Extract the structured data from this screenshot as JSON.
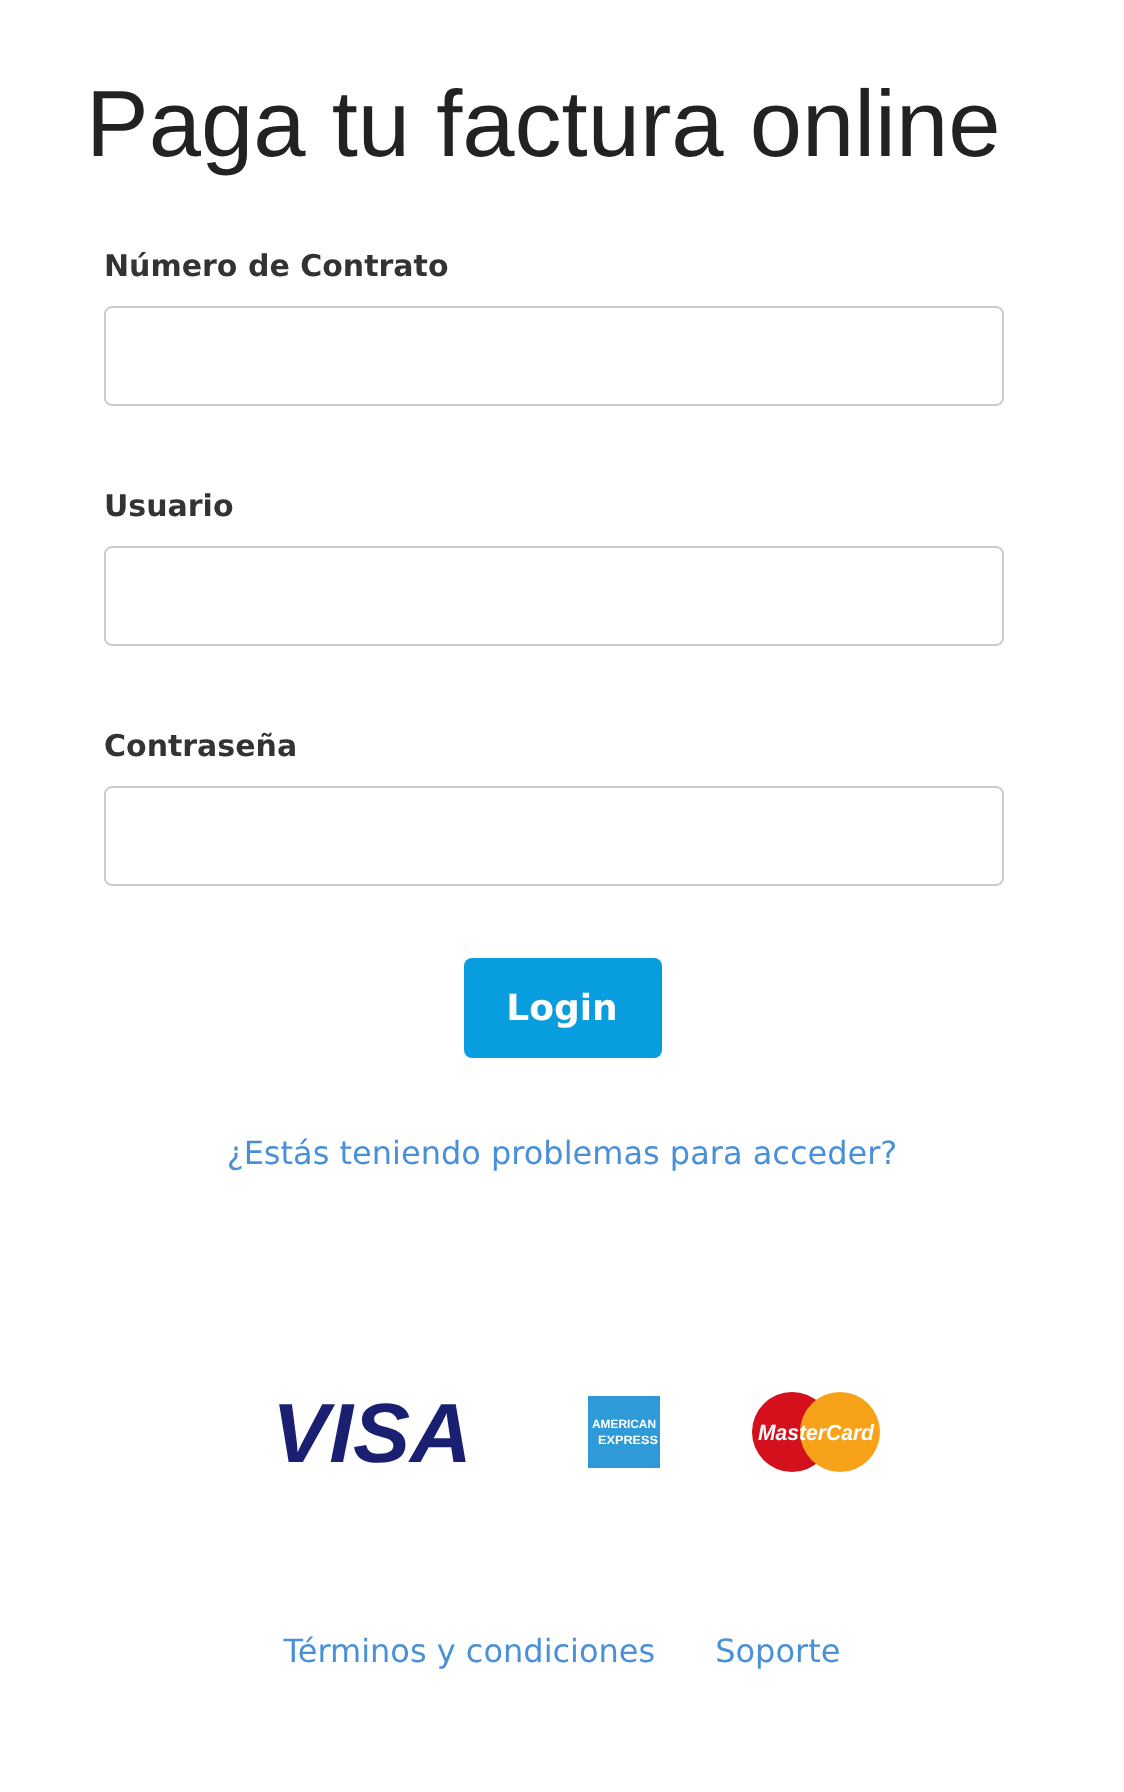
{
  "title": "Paga tu factura online",
  "fields": [
    {
      "label": "Número de Contrato"
    },
    {
      "label": "Usuario"
    },
    {
      "label": "Contraseña"
    }
  ],
  "login_button": "Login",
  "help_link": "¿Estás teniendo problemas para acceder?",
  "payment_logos": [
    {
      "kind": "visa",
      "text": "VISA"
    },
    {
      "kind": "amex",
      "text": "AMERICAN EXPRESS"
    },
    {
      "kind": "mastercard",
      "text": "MasterCard"
    }
  ],
  "footer_links": [
    "Términos y condiciones",
    "Soporte"
  ]
}
